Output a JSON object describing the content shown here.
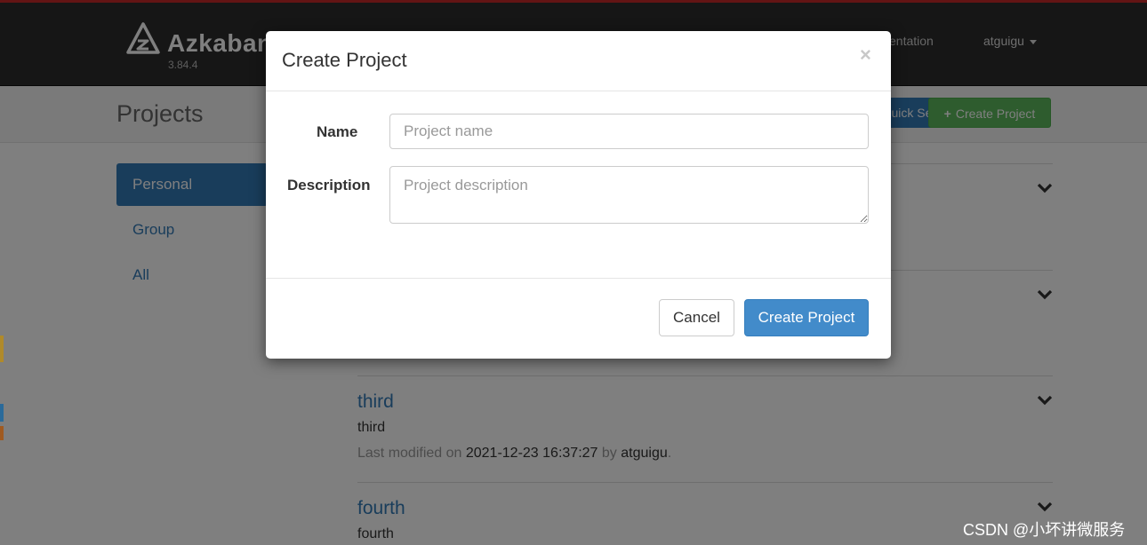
{
  "header": {
    "brand": "Azkaban",
    "version": "3.84.4",
    "nav_documentation": "entation",
    "nav_user": "atguigu"
  },
  "page": {
    "title": "Projects",
    "quick_search_label": "Quick Se",
    "create_project_label": "Create Project"
  },
  "sidebar": {
    "items": [
      {
        "label": "Personal",
        "active": true
      },
      {
        "label": "Group",
        "active": false
      },
      {
        "label": "All",
        "active": false
      }
    ]
  },
  "projects": [
    {
      "name": "third",
      "description": "third",
      "meta_prefix": "Last modified on",
      "modified": "2021-12-23 16:37:27",
      "meta_by": "by",
      "user": "atguigu",
      "meta_end": "."
    },
    {
      "name": "fourth",
      "description": "fourth"
    }
  ],
  "modal": {
    "title": "Create Project",
    "close_symbol": "×",
    "name_label": "Name",
    "name_placeholder": "Project name",
    "description_label": "Description",
    "description_placeholder": "Project description",
    "cancel_label": "Cancel",
    "submit_label": "Create Project"
  },
  "watermark": "CSDN @小坏讲微服务",
  "colors": {
    "navbar": "#2d2d2d",
    "primary": "#337ab7",
    "success": "#5cb85c",
    "submit": "#428bca"
  }
}
